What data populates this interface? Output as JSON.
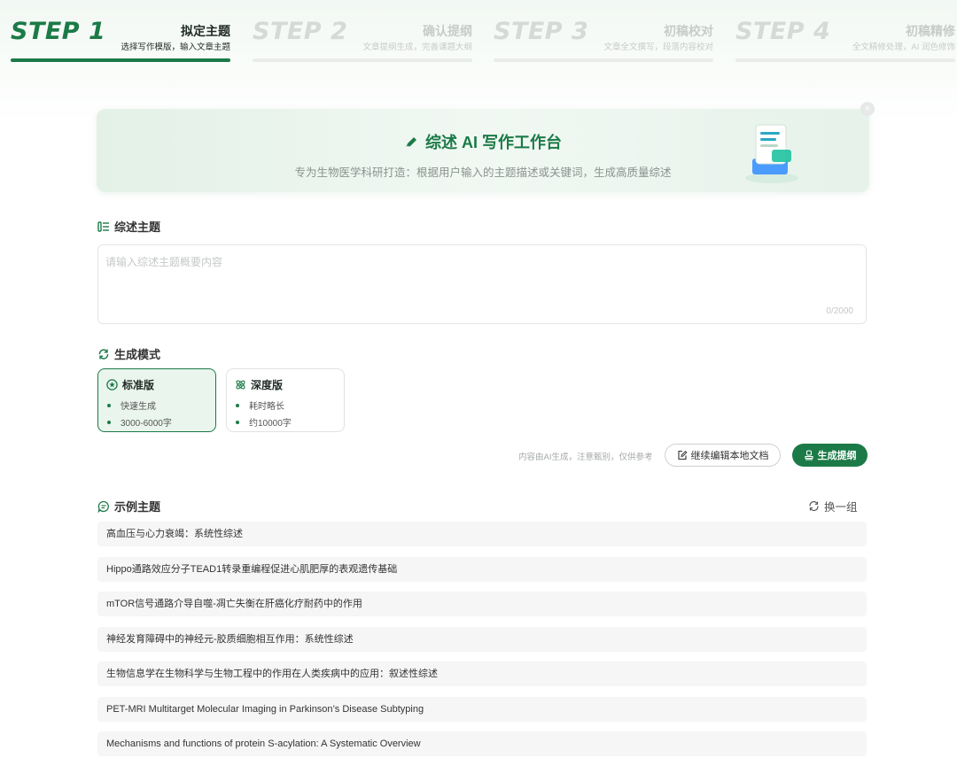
{
  "steps": [
    {
      "num": "STEP 1",
      "title": "拟定主题",
      "subtitle": "选择写作模版，输入文章主题"
    },
    {
      "num": "STEP 2",
      "title": "确认提纲",
      "subtitle": "文章提纲生成，完善课题大纲"
    },
    {
      "num": "STEP 3",
      "title": "初稿校对",
      "subtitle": "文章全文撰写，段落内容校对"
    },
    {
      "num": "STEP 4",
      "title": "初稿精修",
      "subtitle": "全文精修处理，AI 润色修饰"
    }
  ],
  "banner": {
    "title": "综述 AI 写作工作台",
    "subtitle": "专为生物医学科研打造：根据用户输入的主题描述或关键词，生成高质量综述",
    "close": "×"
  },
  "topic": {
    "label": "综述主题",
    "placeholder": "请输入综述主题概要内容",
    "value": "",
    "counter": "0/2000"
  },
  "mode": {
    "label": "生成模式",
    "options": [
      {
        "name": "标准版",
        "items": [
          "快速生成",
          "3000-6000字"
        ],
        "selected": true
      },
      {
        "name": "深度版",
        "items": [
          "耗时略长",
          "约10000字"
        ],
        "selected": false
      }
    ]
  },
  "actions": {
    "disclaimer": "内容由AI生成，注意甄别，仅供参考",
    "continue_label": "继续编辑本地文档",
    "generate_label": "生成提纲"
  },
  "examples": {
    "label": "示例主题",
    "refresh_label": "换一组",
    "items": [
      "高血压与心力衰竭：系统性综述",
      "Hippo通路效应分子TEAD1转录重编程促进心肌肥厚的表观遗传基础",
      "mTOR信号通路介导自噬-凋亡失衡在肝癌化疗耐药中的作用",
      "神经发育障碍中的神经元-胶质细胞相互作用：系统性综述",
      "生物信息学在生物科学与生物工程中的作用在人类疾病中的应用：叙述性综述",
      "PET-MRI Multitarget Molecular Imaging in Parkinson’s Disease Subtyping",
      "Mechanisms and functions of protein S-acylation: A Systematic Overview"
    ]
  },
  "colors": {
    "accent": "#1b7a47",
    "accent_light": "#eaf5ee",
    "muted": "#c8ccc9"
  }
}
